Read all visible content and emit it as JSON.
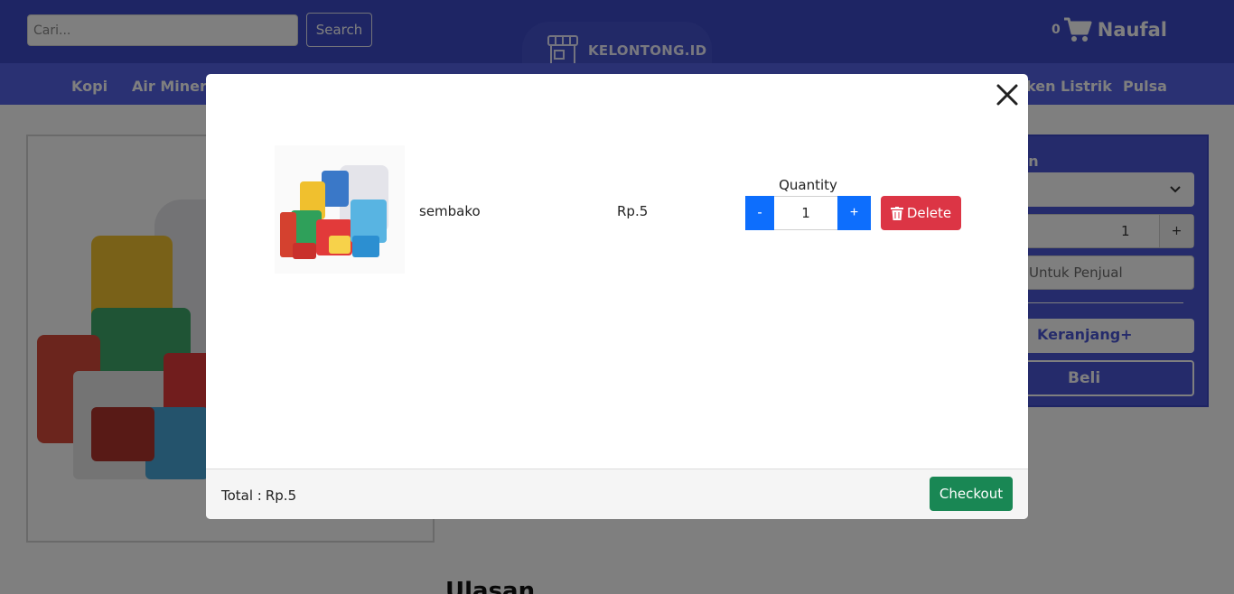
{
  "header": {
    "search_placeholder": "Cari...",
    "search_button": "Search",
    "logo_text": "KELONTONG.ID",
    "cart_count": "0",
    "user_name": "Naufal"
  },
  "nav": {
    "items": [
      {
        "label": "Kopi"
      },
      {
        "label": "Air Minera"
      },
      {
        "label": "ken Listrik"
      },
      {
        "label": "Pulsa"
      }
    ]
  },
  "order_panel": {
    "heading": "ian",
    "quantity": "1",
    "plus": "+",
    "note": "Untuk Penjual",
    "cart_button": "Keranjang+",
    "buy_button": "Beli"
  },
  "review": {
    "heading": "Ulasan"
  },
  "modal": {
    "item": {
      "name": "sembako",
      "price": "Rp.5",
      "quantity_label": "Quantity",
      "quantity": "1",
      "minus": "-",
      "plus": "+",
      "delete": "Delete"
    },
    "footer": {
      "total_label": "Total :",
      "total_value": "Rp.5",
      "checkout": "Checkout"
    }
  },
  "icons": {
    "close": "close-icon",
    "cart": "cart-icon",
    "trash": "trash-icon",
    "store": "store-icon",
    "chevron": "chevron-down-icon"
  },
  "colors": {
    "header": "#3d4bc9",
    "navbar": "#5462e6",
    "primary": "#0d6efd",
    "danger": "#dc3545",
    "success": "#198754"
  }
}
